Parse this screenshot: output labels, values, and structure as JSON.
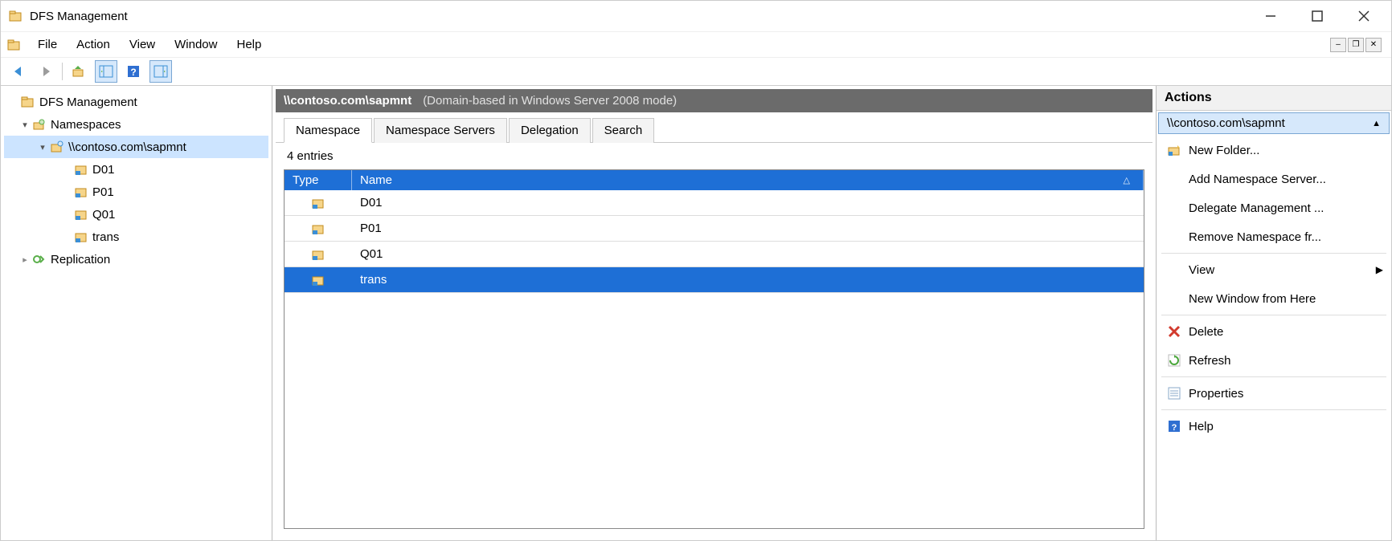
{
  "window": {
    "title": "DFS Management"
  },
  "menubar": [
    "File",
    "Action",
    "View",
    "Window",
    "Help"
  ],
  "tree": {
    "root": "DFS Management",
    "namespaces_label": "Namespaces",
    "selected_namespace": "\\\\contoso.com\\sapmnt",
    "folders": [
      "D01",
      "P01",
      "Q01",
      "trans"
    ],
    "replication_label": "Replication"
  },
  "content": {
    "header_path": "\\\\contoso.com\\sapmnt",
    "header_mode": "(Domain-based in Windows Server 2008 mode)",
    "tabs": [
      "Namespace",
      "Namespace Servers",
      "Delegation",
      "Search"
    ],
    "entry_count": "4 entries",
    "columns": {
      "type": "Type",
      "name": "Name"
    },
    "rows": [
      {
        "name": "D01",
        "selected": false
      },
      {
        "name": "P01",
        "selected": false
      },
      {
        "name": "Q01",
        "selected": false
      },
      {
        "name": "trans",
        "selected": true
      }
    ]
  },
  "actions": {
    "title": "Actions",
    "scope": "\\\\contoso.com\\sapmnt",
    "items": [
      {
        "label": "New Folder...",
        "icon": "folder-new"
      },
      {
        "label": "Add Namespace Server...",
        "icon": "none"
      },
      {
        "label": "Delegate Management ...",
        "icon": "none"
      },
      {
        "label": "Remove Namespace fr...",
        "icon": "none"
      },
      {
        "label": "View",
        "icon": "none",
        "submenu": true,
        "sep_before": true
      },
      {
        "label": "New Window from Here",
        "icon": "none"
      },
      {
        "label": "Delete",
        "icon": "delete",
        "sep_before": true
      },
      {
        "label": "Refresh",
        "icon": "refresh"
      },
      {
        "label": "Properties",
        "icon": "properties",
        "sep_before": true
      },
      {
        "label": "Help",
        "icon": "help",
        "sep_before": true
      }
    ]
  }
}
